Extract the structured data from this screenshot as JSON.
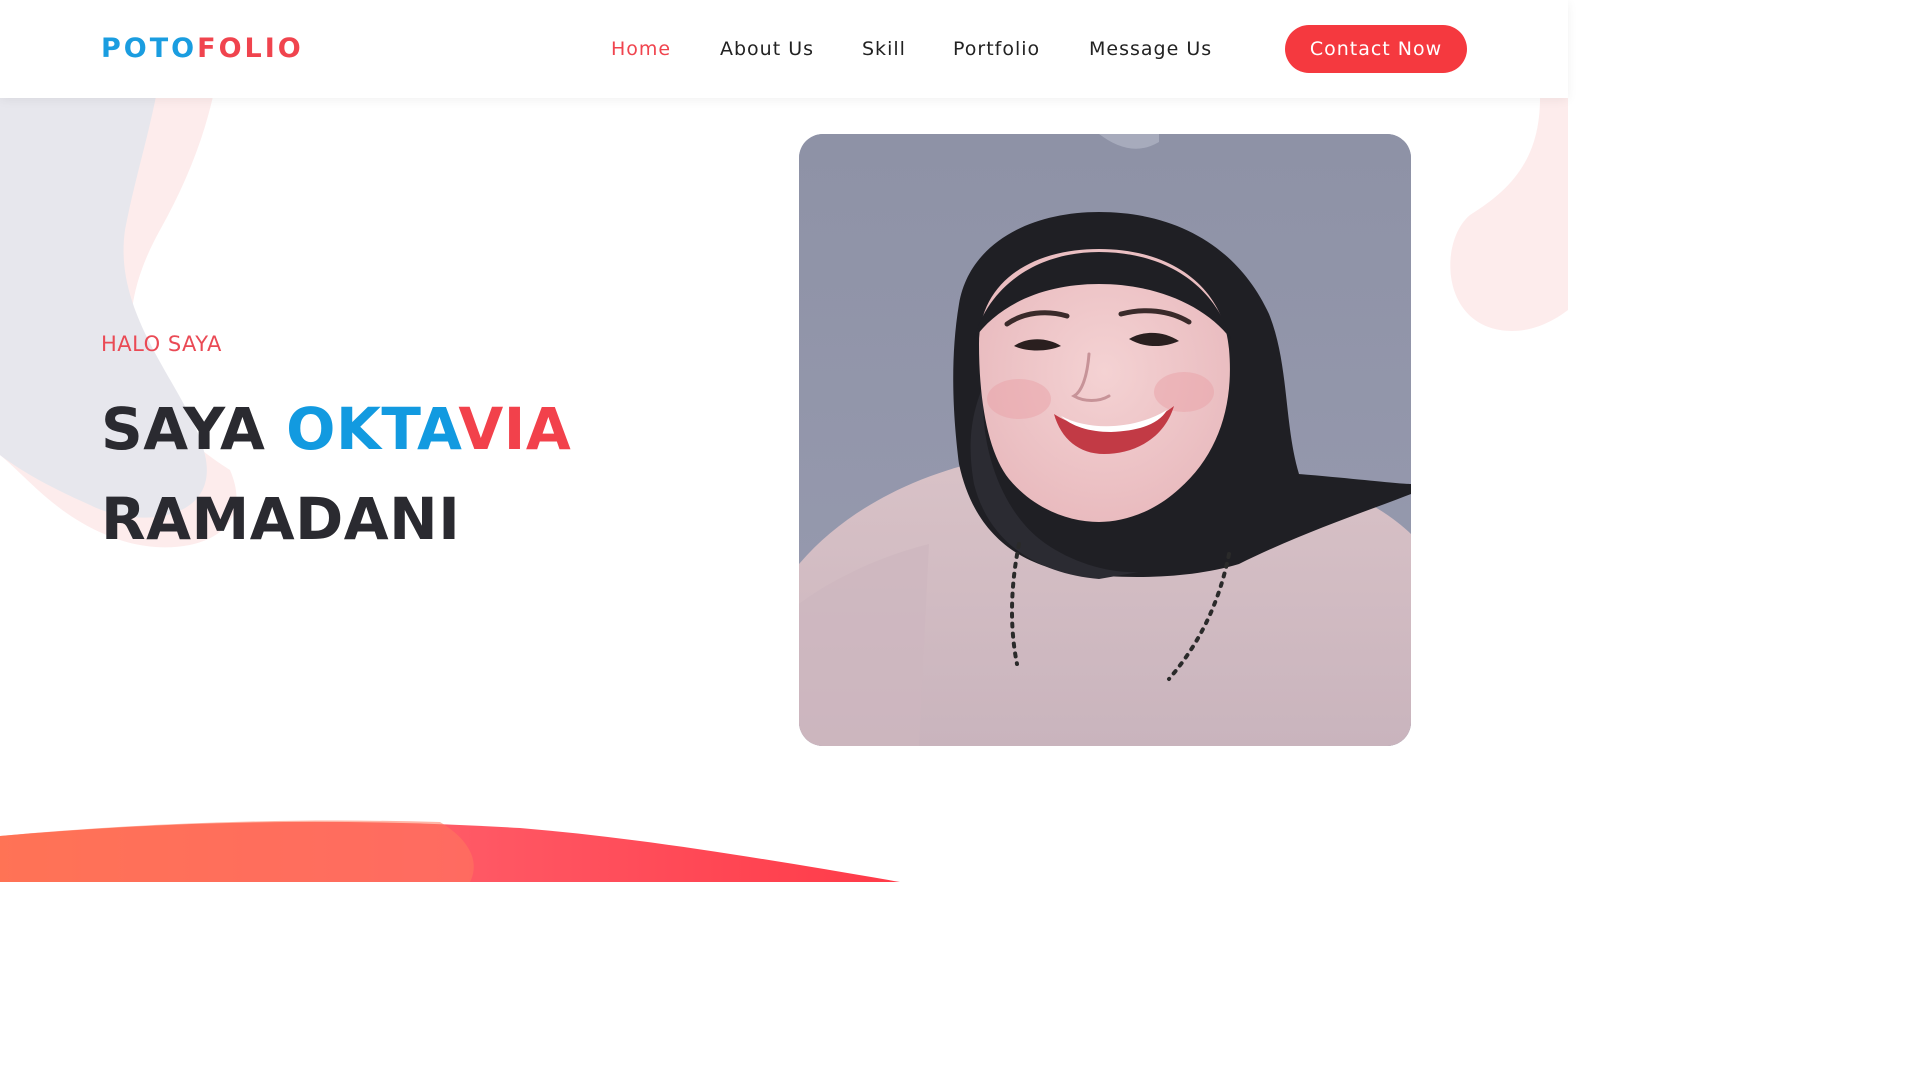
{
  "brand": {
    "part1": "POTO",
    "part2": "FOLIO"
  },
  "nav": {
    "home": "Home",
    "about": "About Us",
    "skill": "Skill",
    "portfolio": "Portfolio",
    "message": "Message Us",
    "contact_button": "Contact Now",
    "active": "Home"
  },
  "hero": {
    "greeting": "HALO SAYA",
    "title_prefix": "SAYA ",
    "name_blue": "OKTA",
    "name_red": "VIA",
    "last_name": "RAMADANI"
  },
  "colors": {
    "accent_red": "#f0444e",
    "accent_blue": "#1a9de0",
    "heading_dark": "#2a2a30"
  },
  "icons": {
    "profile_photo": "portrait-photo"
  }
}
